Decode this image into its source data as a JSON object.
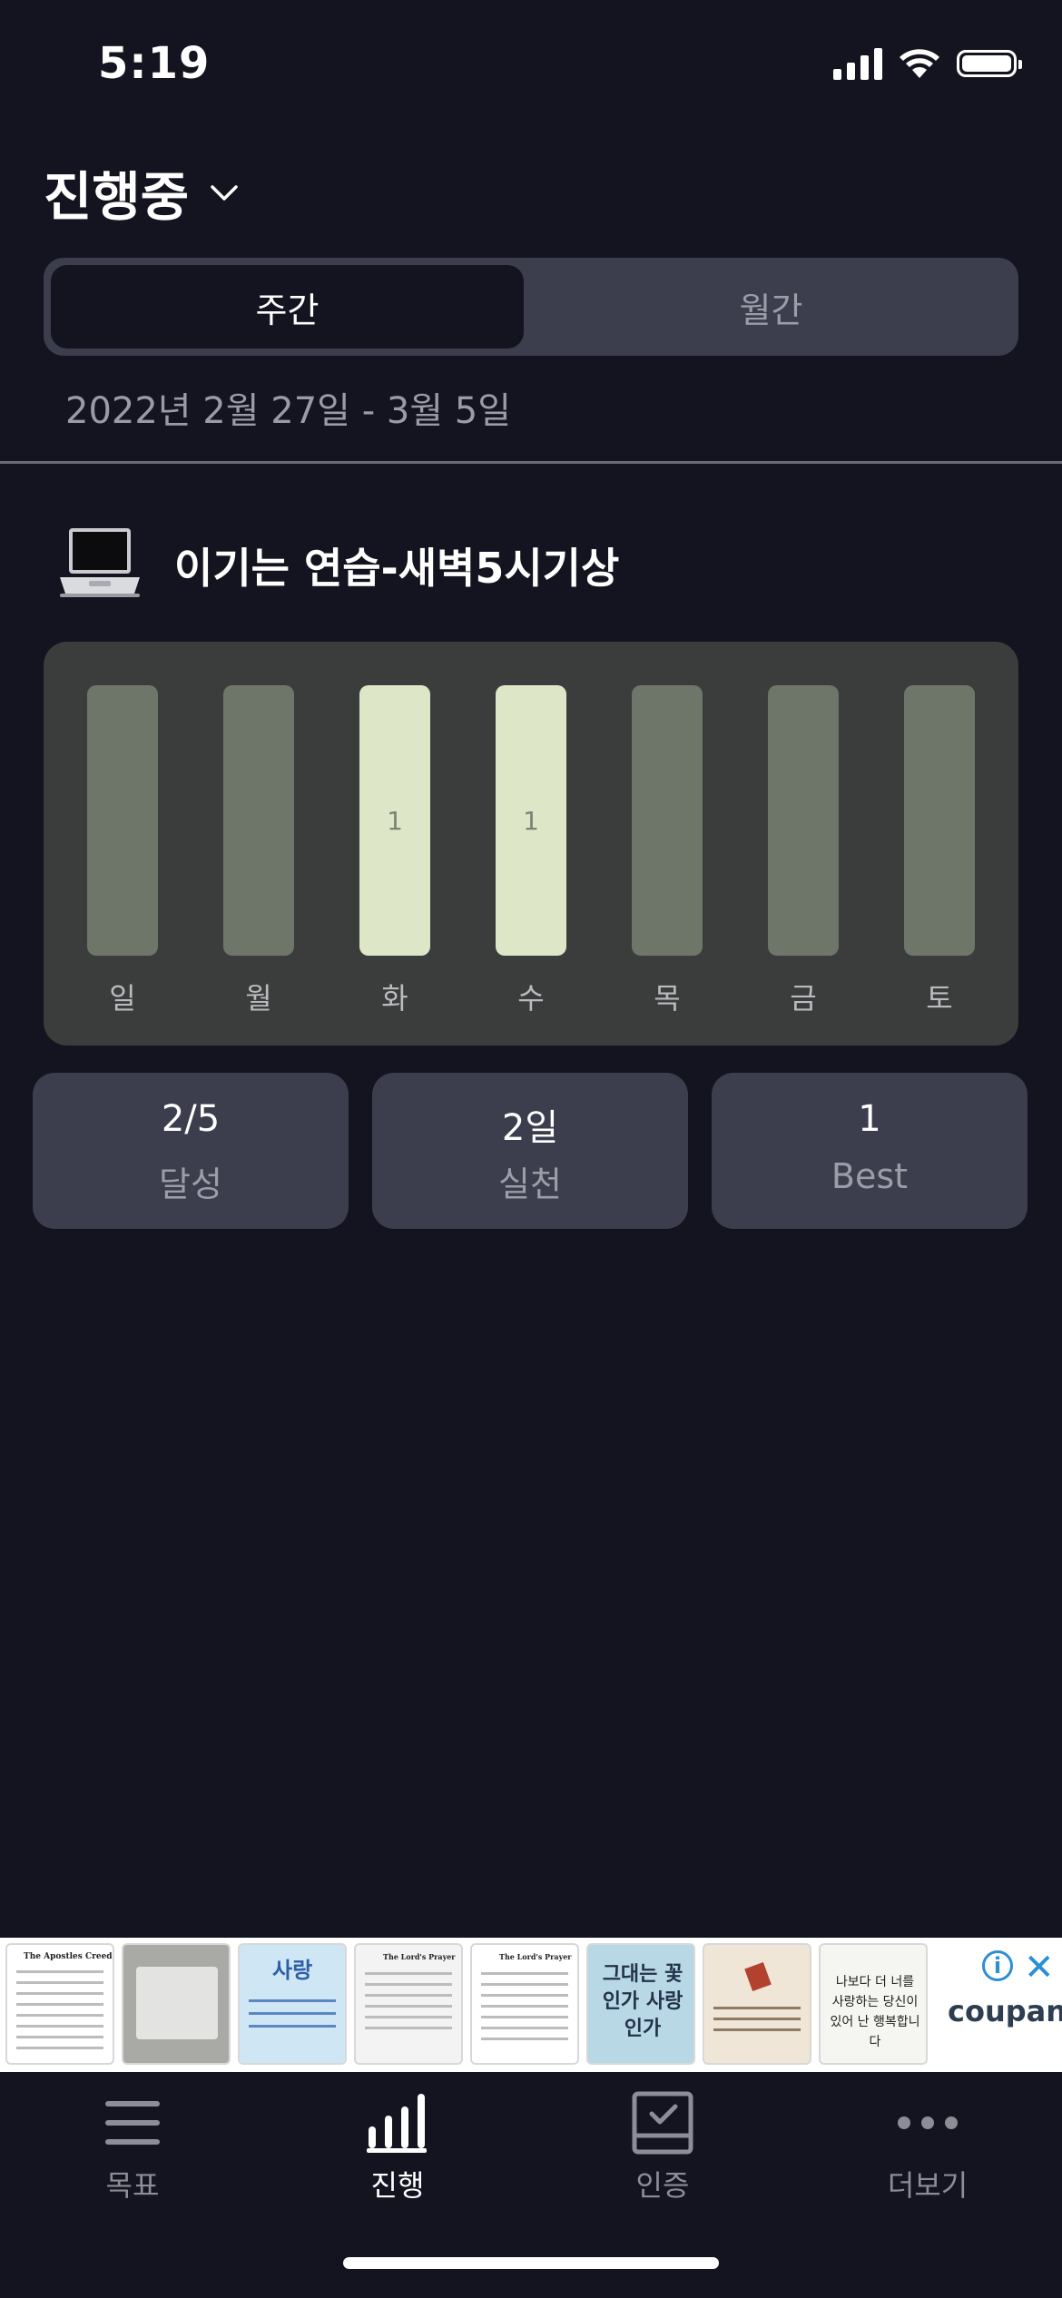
{
  "status_bar": {
    "time": "5:19"
  },
  "header": {
    "title": "진행중"
  },
  "segment": {
    "weekly": "주간",
    "monthly": "월간"
  },
  "date_range": "2022년 2월 27일  -  3월 5일",
  "goal": {
    "title": "이기는 연습-새벽5시기상",
    "icon": "laptop-icon"
  },
  "weekly_chart": {
    "days": [
      {
        "label": "일",
        "count": "",
        "done": false
      },
      {
        "label": "월",
        "count": "",
        "done": false
      },
      {
        "label": "화",
        "count": "1",
        "done": true
      },
      {
        "label": "수",
        "count": "1",
        "done": true
      },
      {
        "label": "목",
        "count": "",
        "done": false
      },
      {
        "label": "금",
        "count": "",
        "done": false
      },
      {
        "label": "토",
        "count": "",
        "done": false
      }
    ],
    "colors": {
      "done": "#dde6c6",
      "pending": "#6e7569"
    }
  },
  "stats": [
    {
      "value": "2/5",
      "label": "달성"
    },
    {
      "value": "2일",
      "label": "실천"
    },
    {
      "value": "1",
      "label": "Best"
    }
  ],
  "ad": {
    "brand": "coupang",
    "thumb_texts": [
      "The Apostles Creed",
      "",
      "사랑",
      "The Lord's Prayer",
      "The Lord's Prayer",
      "그대는 꽃인가 사랑인가",
      "",
      "나보다 더 너를 사랑하는 당신이 있어 난 행복합니다"
    ]
  },
  "tabs": [
    {
      "label": "목표",
      "icon": "list-icon",
      "active": false
    },
    {
      "label": "진행",
      "icon": "bar-chart-icon",
      "active": true
    },
    {
      "label": "인증",
      "icon": "check-box-icon",
      "active": false
    },
    {
      "label": "더보기",
      "icon": "more-dots-icon",
      "active": false
    }
  ]
}
